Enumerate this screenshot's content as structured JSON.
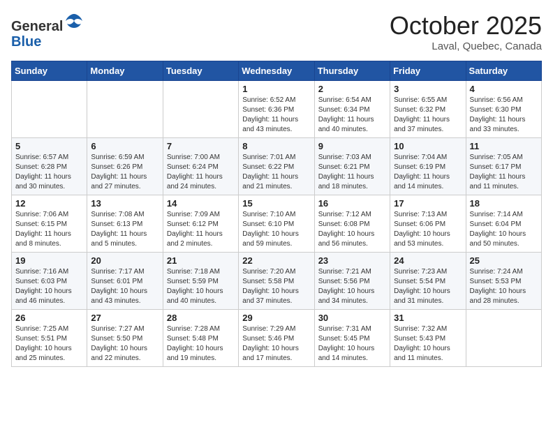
{
  "header": {
    "logo_line1": "General",
    "logo_line2": "Blue",
    "month_title": "October 2025",
    "location": "Laval, Quebec, Canada"
  },
  "days_of_week": [
    "Sunday",
    "Monday",
    "Tuesday",
    "Wednesday",
    "Thursday",
    "Friday",
    "Saturday"
  ],
  "weeks": [
    [
      {
        "day": "",
        "info": ""
      },
      {
        "day": "",
        "info": ""
      },
      {
        "day": "",
        "info": ""
      },
      {
        "day": "1",
        "info": "Sunrise: 6:52 AM\nSunset: 6:36 PM\nDaylight: 11 hours and 43 minutes."
      },
      {
        "day": "2",
        "info": "Sunrise: 6:54 AM\nSunset: 6:34 PM\nDaylight: 11 hours and 40 minutes."
      },
      {
        "day": "3",
        "info": "Sunrise: 6:55 AM\nSunset: 6:32 PM\nDaylight: 11 hours and 37 minutes."
      },
      {
        "day": "4",
        "info": "Sunrise: 6:56 AM\nSunset: 6:30 PM\nDaylight: 11 hours and 33 minutes."
      }
    ],
    [
      {
        "day": "5",
        "info": "Sunrise: 6:57 AM\nSunset: 6:28 PM\nDaylight: 11 hours and 30 minutes."
      },
      {
        "day": "6",
        "info": "Sunrise: 6:59 AM\nSunset: 6:26 PM\nDaylight: 11 hours and 27 minutes."
      },
      {
        "day": "7",
        "info": "Sunrise: 7:00 AM\nSunset: 6:24 PM\nDaylight: 11 hours and 24 minutes."
      },
      {
        "day": "8",
        "info": "Sunrise: 7:01 AM\nSunset: 6:22 PM\nDaylight: 11 hours and 21 minutes."
      },
      {
        "day": "9",
        "info": "Sunrise: 7:03 AM\nSunset: 6:21 PM\nDaylight: 11 hours and 18 minutes."
      },
      {
        "day": "10",
        "info": "Sunrise: 7:04 AM\nSunset: 6:19 PM\nDaylight: 11 hours and 14 minutes."
      },
      {
        "day": "11",
        "info": "Sunrise: 7:05 AM\nSunset: 6:17 PM\nDaylight: 11 hours and 11 minutes."
      }
    ],
    [
      {
        "day": "12",
        "info": "Sunrise: 7:06 AM\nSunset: 6:15 PM\nDaylight: 11 hours and 8 minutes."
      },
      {
        "day": "13",
        "info": "Sunrise: 7:08 AM\nSunset: 6:13 PM\nDaylight: 11 hours and 5 minutes."
      },
      {
        "day": "14",
        "info": "Sunrise: 7:09 AM\nSunset: 6:12 PM\nDaylight: 11 hours and 2 minutes."
      },
      {
        "day": "15",
        "info": "Sunrise: 7:10 AM\nSunset: 6:10 PM\nDaylight: 10 hours and 59 minutes."
      },
      {
        "day": "16",
        "info": "Sunrise: 7:12 AM\nSunset: 6:08 PM\nDaylight: 10 hours and 56 minutes."
      },
      {
        "day": "17",
        "info": "Sunrise: 7:13 AM\nSunset: 6:06 PM\nDaylight: 10 hours and 53 minutes."
      },
      {
        "day": "18",
        "info": "Sunrise: 7:14 AM\nSunset: 6:04 PM\nDaylight: 10 hours and 50 minutes."
      }
    ],
    [
      {
        "day": "19",
        "info": "Sunrise: 7:16 AM\nSunset: 6:03 PM\nDaylight: 10 hours and 46 minutes."
      },
      {
        "day": "20",
        "info": "Sunrise: 7:17 AM\nSunset: 6:01 PM\nDaylight: 10 hours and 43 minutes."
      },
      {
        "day": "21",
        "info": "Sunrise: 7:18 AM\nSunset: 5:59 PM\nDaylight: 10 hours and 40 minutes."
      },
      {
        "day": "22",
        "info": "Sunrise: 7:20 AM\nSunset: 5:58 PM\nDaylight: 10 hours and 37 minutes."
      },
      {
        "day": "23",
        "info": "Sunrise: 7:21 AM\nSunset: 5:56 PM\nDaylight: 10 hours and 34 minutes."
      },
      {
        "day": "24",
        "info": "Sunrise: 7:23 AM\nSunset: 5:54 PM\nDaylight: 10 hours and 31 minutes."
      },
      {
        "day": "25",
        "info": "Sunrise: 7:24 AM\nSunset: 5:53 PM\nDaylight: 10 hours and 28 minutes."
      }
    ],
    [
      {
        "day": "26",
        "info": "Sunrise: 7:25 AM\nSunset: 5:51 PM\nDaylight: 10 hours and 25 minutes."
      },
      {
        "day": "27",
        "info": "Sunrise: 7:27 AM\nSunset: 5:50 PM\nDaylight: 10 hours and 22 minutes."
      },
      {
        "day": "28",
        "info": "Sunrise: 7:28 AM\nSunset: 5:48 PM\nDaylight: 10 hours and 19 minutes."
      },
      {
        "day": "29",
        "info": "Sunrise: 7:29 AM\nSunset: 5:46 PM\nDaylight: 10 hours and 17 minutes."
      },
      {
        "day": "30",
        "info": "Sunrise: 7:31 AM\nSunset: 5:45 PM\nDaylight: 10 hours and 14 minutes."
      },
      {
        "day": "31",
        "info": "Sunrise: 7:32 AM\nSunset: 5:43 PM\nDaylight: 10 hours and 11 minutes."
      },
      {
        "day": "",
        "info": ""
      }
    ]
  ]
}
